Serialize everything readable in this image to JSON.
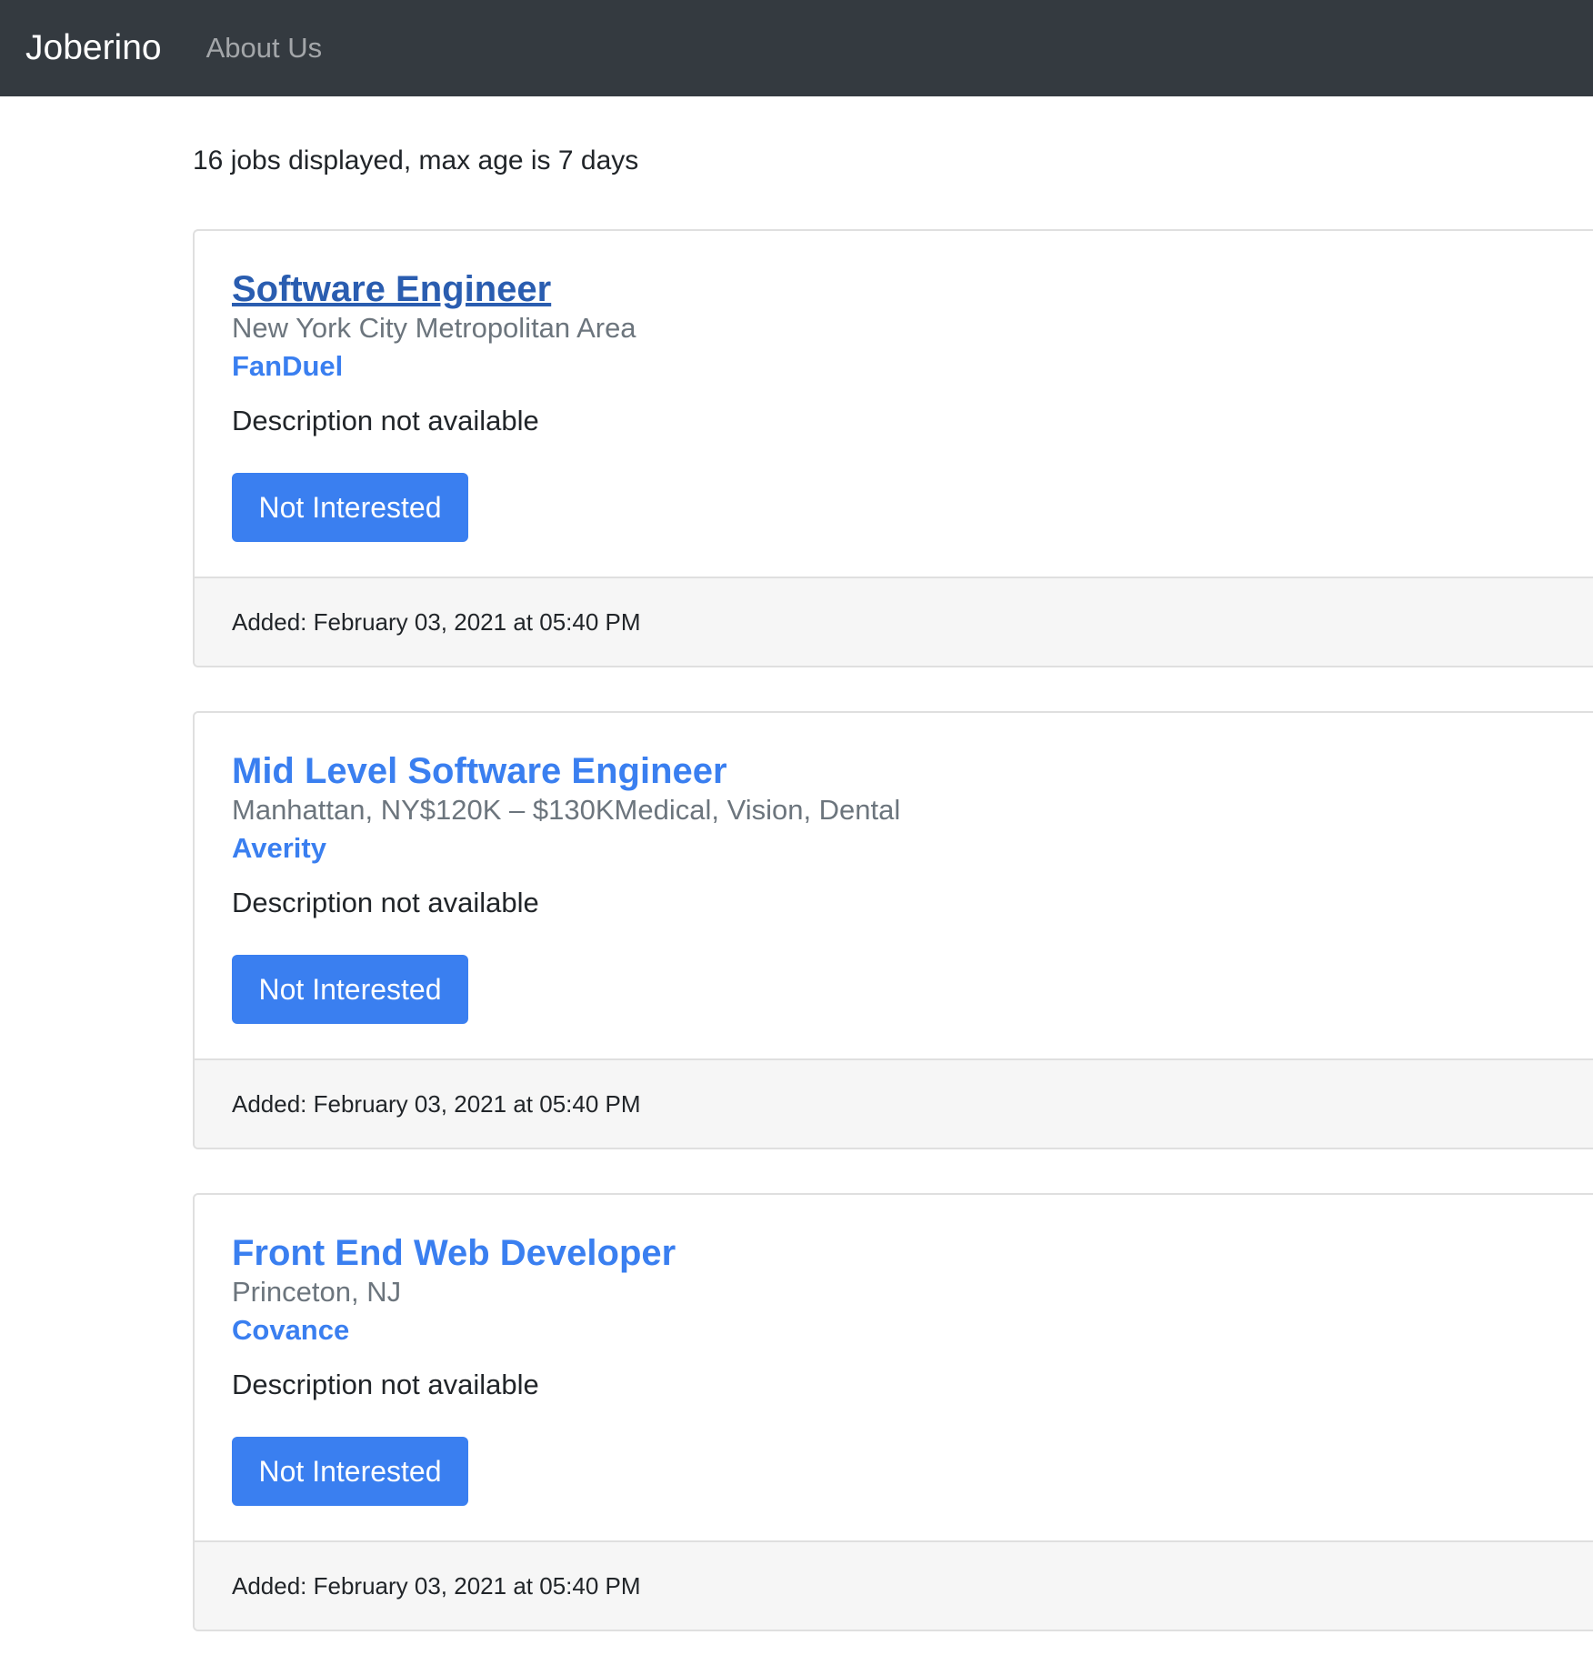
{
  "nav": {
    "brand": "Joberino",
    "about": "About Us"
  },
  "summary": "16 jobs displayed, max age is 7 days",
  "jobs": [
    {
      "title": "Software Engineer",
      "location": "New York City Metropolitan Area",
      "company": "FanDuel",
      "description": "Description not available",
      "button": "Not Interested",
      "added": "Added: February 03, 2021 at 05:40 PM"
    },
    {
      "title": "Mid Level Software Engineer",
      "location": "Manhattan, NY$120K – $130KMedical, Vision, Dental",
      "company": "Averity",
      "description": "Description not available",
      "button": "Not Interested",
      "added": "Added: February 03, 2021 at 05:40 PM"
    },
    {
      "title": "Front End Web Developer",
      "location": "Princeton, NJ",
      "company": "Covance",
      "description": "Description not available",
      "button": "Not Interested",
      "added": "Added: February 03, 2021 at 05:40 PM"
    }
  ]
}
